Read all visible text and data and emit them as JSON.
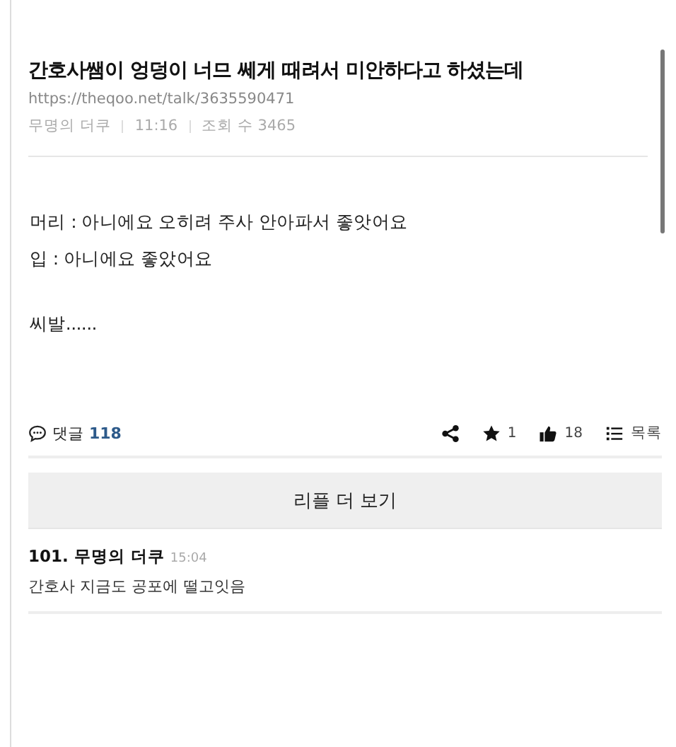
{
  "post": {
    "title": "간호사쌤이 엉덩이 너므 쎄게 때려서 미안하다고 하셨는데",
    "url": "https://theqoo.net/talk/3635590471",
    "author": "무명의 더쿠",
    "time": "11:16",
    "views": "조회 수 3465"
  },
  "body": [
    {
      "lines": [
        "머리 : 아니에요 오히려 주사 안아파서 좋앗어요",
        "입 : 아니에요 좋았어요"
      ]
    },
    {
      "lines": [
        "씨발......"
      ]
    }
  ],
  "footer": {
    "comments_label": "댓글",
    "comments_count": "118",
    "stars": "1",
    "likes": "18",
    "list_label": "목록"
  },
  "more_button": "리플 더 보기",
  "comments": [
    {
      "number": "101.",
      "author": "무명의 더쿠",
      "time": "15:04",
      "text": "간호사 지금도 공포에 떨고잇음"
    }
  ]
}
